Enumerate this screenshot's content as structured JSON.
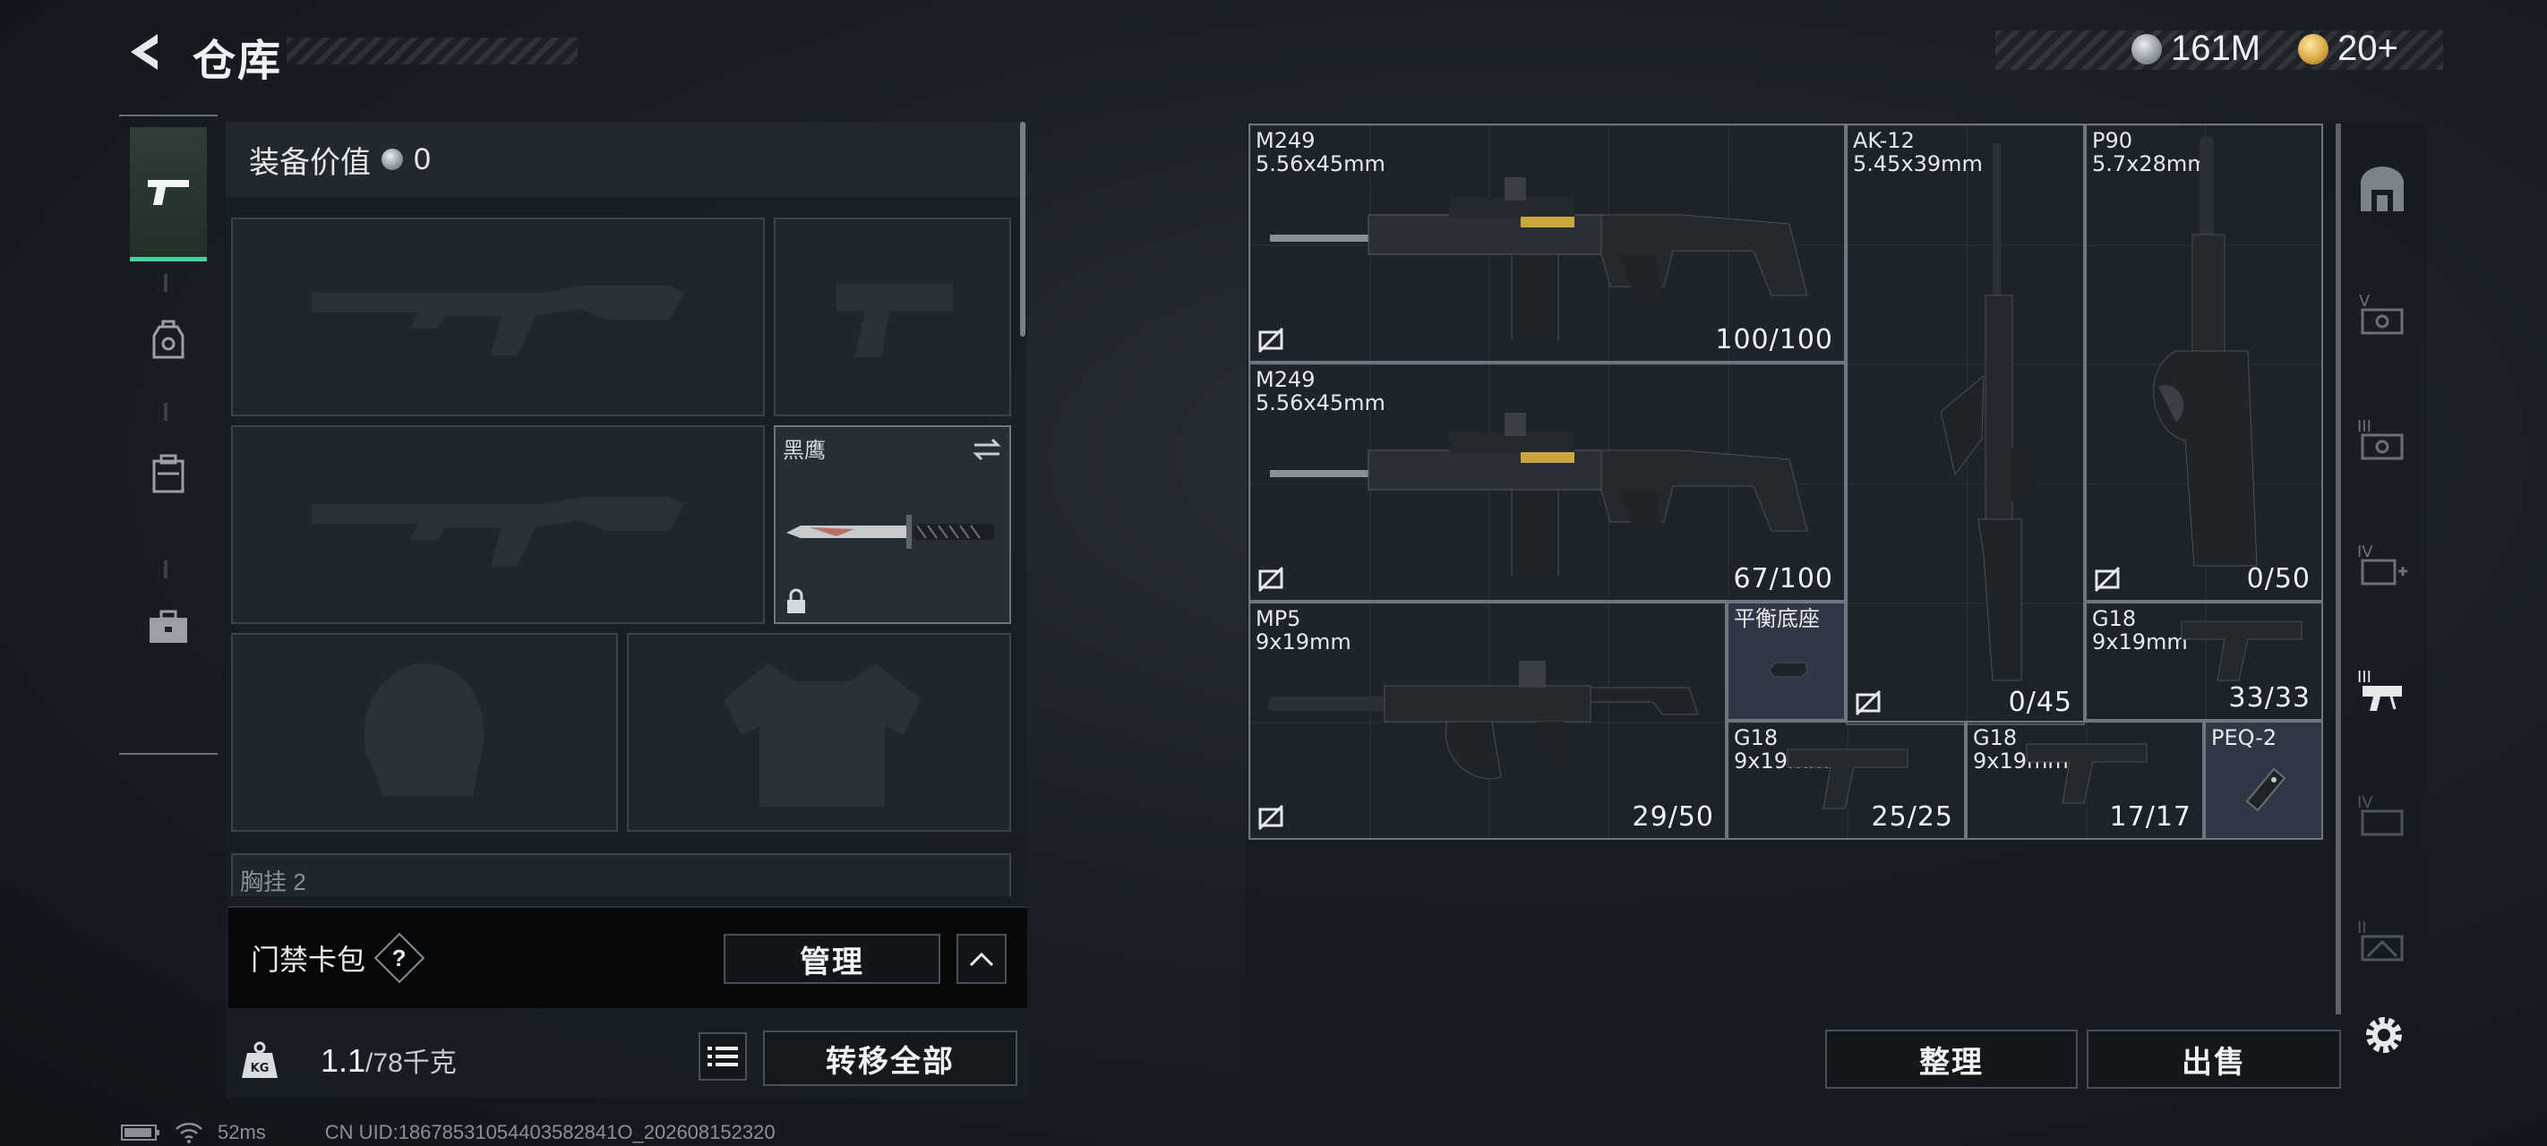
{
  "header": {
    "title": "仓库"
  },
  "currency": {
    "silver": "161M",
    "gold": "20+"
  },
  "equip": {
    "header_label": "装备价值",
    "header_value": "0",
    "knife_slot_label": "黑鹰",
    "chest_label_partial": "胸挂 2"
  },
  "access": {
    "label": "门禁卡包",
    "help": "?",
    "manage_label": "管理"
  },
  "weight": {
    "current": "1.1",
    "max": "/78千克",
    "transfer_all_label": "转移全部"
  },
  "stash": {
    "items": [
      {
        "id": "m249-a",
        "name": "M249\n5.56x45mm",
        "ammo": "100/100"
      },
      {
        "id": "ak12",
        "name": "AK-12\n5.45x39mm",
        "ammo": "0/45"
      },
      {
        "id": "p90",
        "name": "P90\n5.7x28mm",
        "ammo": "0/50"
      },
      {
        "id": "m249-b",
        "name": "M249\n5.56x45mm",
        "ammo": "67/100"
      },
      {
        "id": "mp5",
        "name": "MP5\n9x19mm",
        "ammo": "29/50"
      },
      {
        "id": "mount",
        "name": "平衡底座",
        "ammo": ""
      },
      {
        "id": "g18-a",
        "name": "G18\n9x19mm",
        "ammo": "33/33"
      },
      {
        "id": "g18-b",
        "name": "G18\n9x19mm",
        "ammo": "25/25"
      },
      {
        "id": "g18-c",
        "name": "G18\n9x19mm",
        "ammo": "17/17"
      },
      {
        "id": "peq2",
        "name": "PEQ-2",
        "ammo": ""
      }
    ],
    "sort_label": "整理",
    "sell_label": "出售"
  },
  "status": {
    "ping": "52ms",
    "uid": "CN UID:18678531054403582841O_202608152320"
  },
  "colors": {
    "accent": "#46d69a",
    "border": "#6f7680"
  }
}
